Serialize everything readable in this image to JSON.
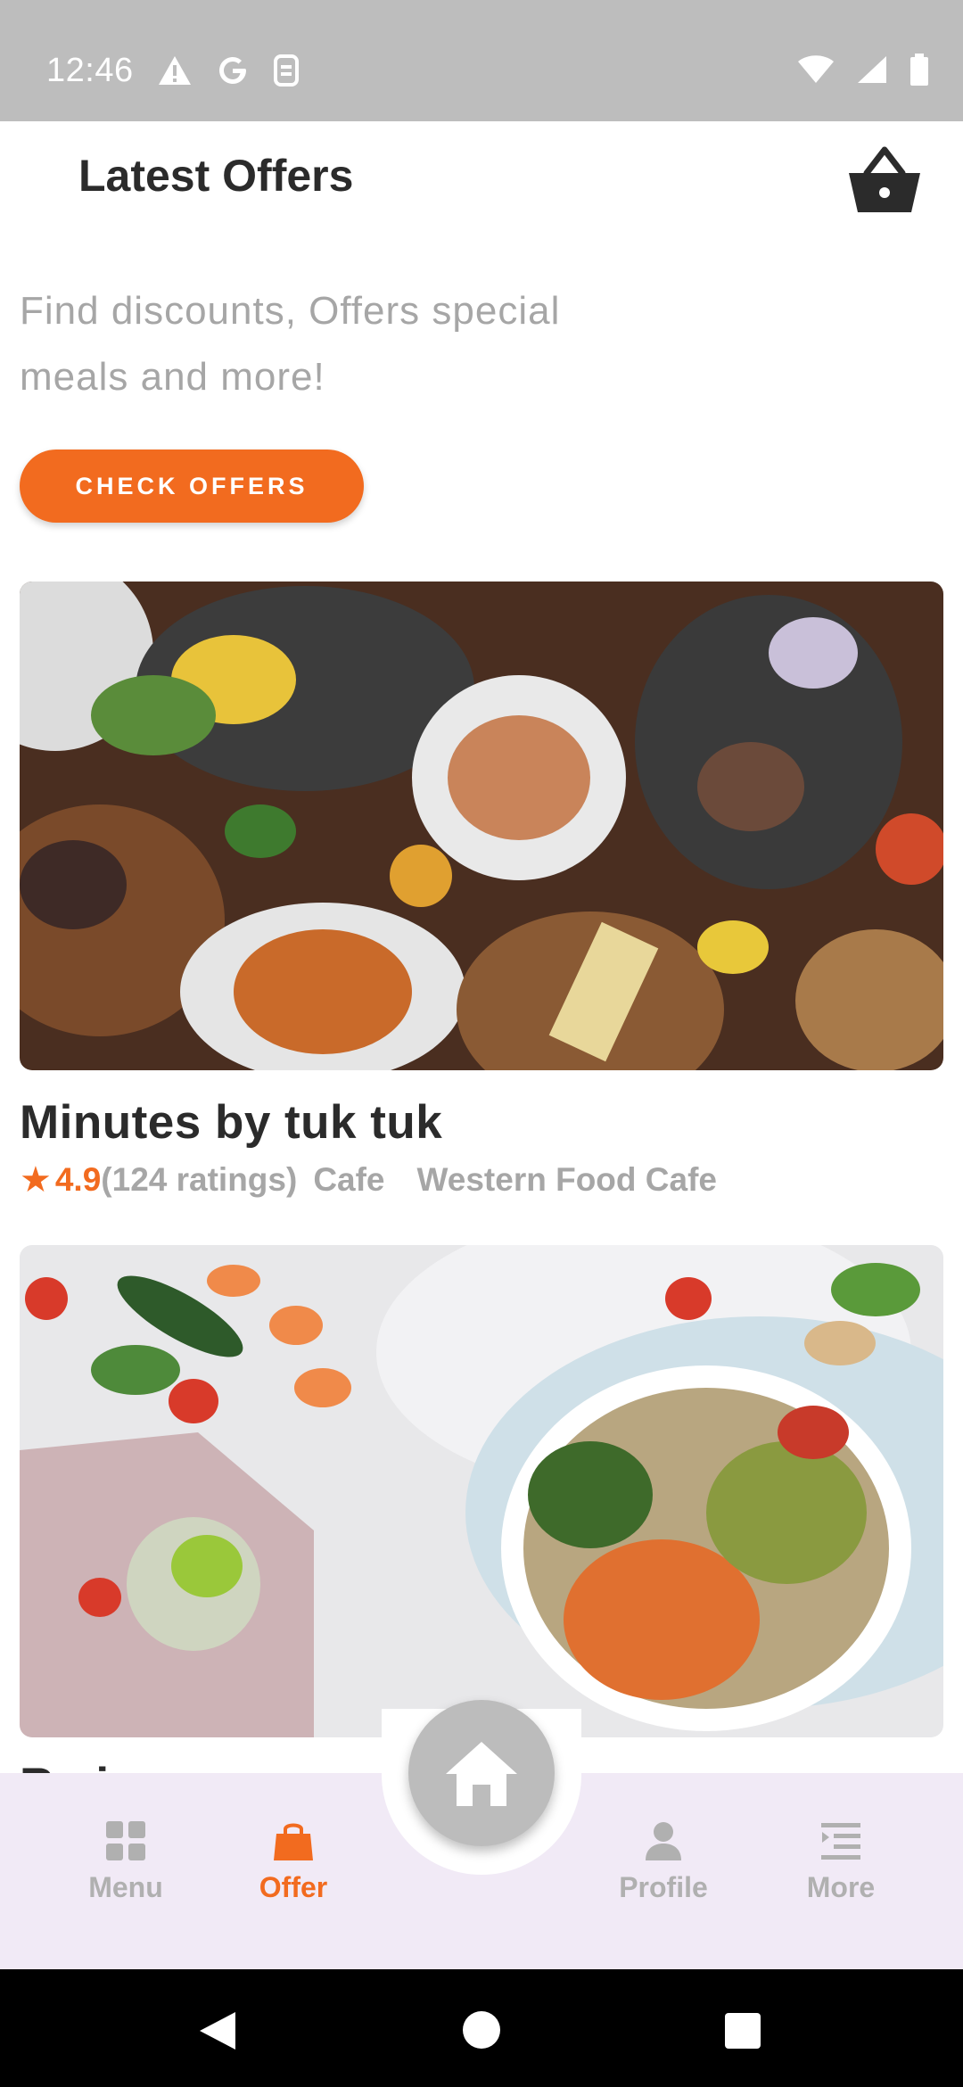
{
  "status_bar": {
    "time": "12:46",
    "left_icons": [
      "warning-icon",
      "google-icon",
      "sim-icon"
    ],
    "right_icons": [
      "wifi-icon",
      "signal-icon",
      "battery-icon"
    ]
  },
  "header": {
    "title": "Latest Offers",
    "cart_icon": "basket-icon"
  },
  "promo": {
    "subtitle": "Find discounts, Offers special meals and more!",
    "button_label": "CHECK OFFERS"
  },
  "restaurants": [
    {
      "name": "Minutes by tuk tuk",
      "rating": "4.9",
      "ratings_count": "(124 ratings)",
      "type": "Cafe",
      "cuisine": "Western Food Cafe"
    },
    {
      "name": "Rminor"
    }
  ],
  "bottom_nav": {
    "items": [
      {
        "label": "Menu",
        "icon": "grid-icon"
      },
      {
        "label": "Offer",
        "icon": "shopping-bag-icon",
        "active": true
      },
      {
        "label": "Profile",
        "icon": "person-icon"
      },
      {
        "label": "More",
        "icon": "list-icon"
      }
    ],
    "home_icon": "home-icon"
  },
  "colors": {
    "accent": "#f26b1f",
    "text_dark": "#2b2b2b",
    "text_muted": "#a6a6a6",
    "nav_bg": "#f1eaf6",
    "status_bar": "#bdbdbd"
  }
}
